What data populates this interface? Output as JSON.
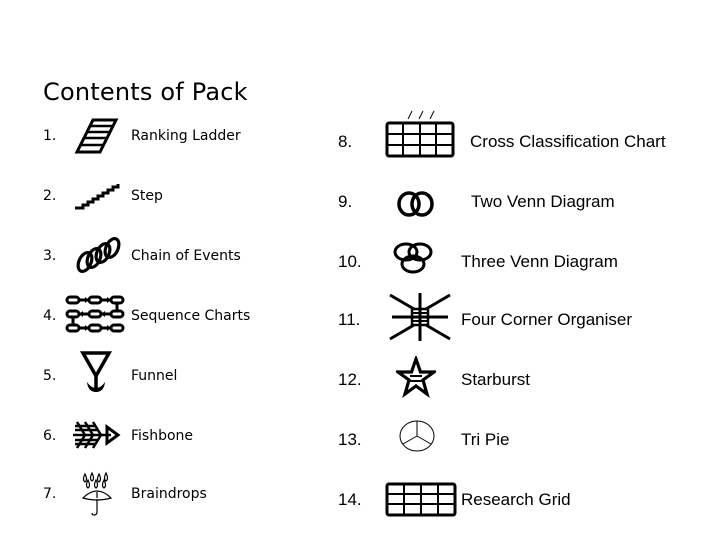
{
  "page": {
    "title": "Contents of Pack"
  },
  "left_items": [
    {
      "number": "1.",
      "label": "Ranking Ladder",
      "icon": "ladder-icon"
    },
    {
      "number": "2.",
      "label": "Step",
      "icon": "step-icon"
    },
    {
      "number": "3.",
      "label": "Chain of Events",
      "icon": "chain-icon"
    },
    {
      "number": "4.",
      "label": "Sequence Charts",
      "icon": "sequence-chart-icon"
    },
    {
      "number": "5.",
      "label": "Funnel",
      "icon": "funnel-icon"
    },
    {
      "number": "6.",
      "label": "Fishbone",
      "icon": "fishbone-icon"
    },
    {
      "number": "7.",
      "label": "Braindrops",
      "icon": "braindrops-icon"
    }
  ],
  "right_items": [
    {
      "number": "8.",
      "label": "Cross Classification Chart",
      "icon": "cross-classification-grid-icon"
    },
    {
      "number": "9.",
      "label": "Two Venn Diagram",
      "icon": "two-venn-icon"
    },
    {
      "number": "10.",
      "label": "Three Venn Diagram",
      "icon": "three-venn-icon"
    },
    {
      "number": "11.",
      "label": "Four Corner Organiser",
      "icon": "four-corner-icon"
    },
    {
      "number": "12.",
      "label": "Starburst",
      "icon": "starburst-icon"
    },
    {
      "number": "13.",
      "label": "Tri Pie",
      "icon": "tri-pie-icon"
    },
    {
      "number": "14.",
      "label": "Research Grid",
      "icon": "research-grid-icon"
    }
  ]
}
